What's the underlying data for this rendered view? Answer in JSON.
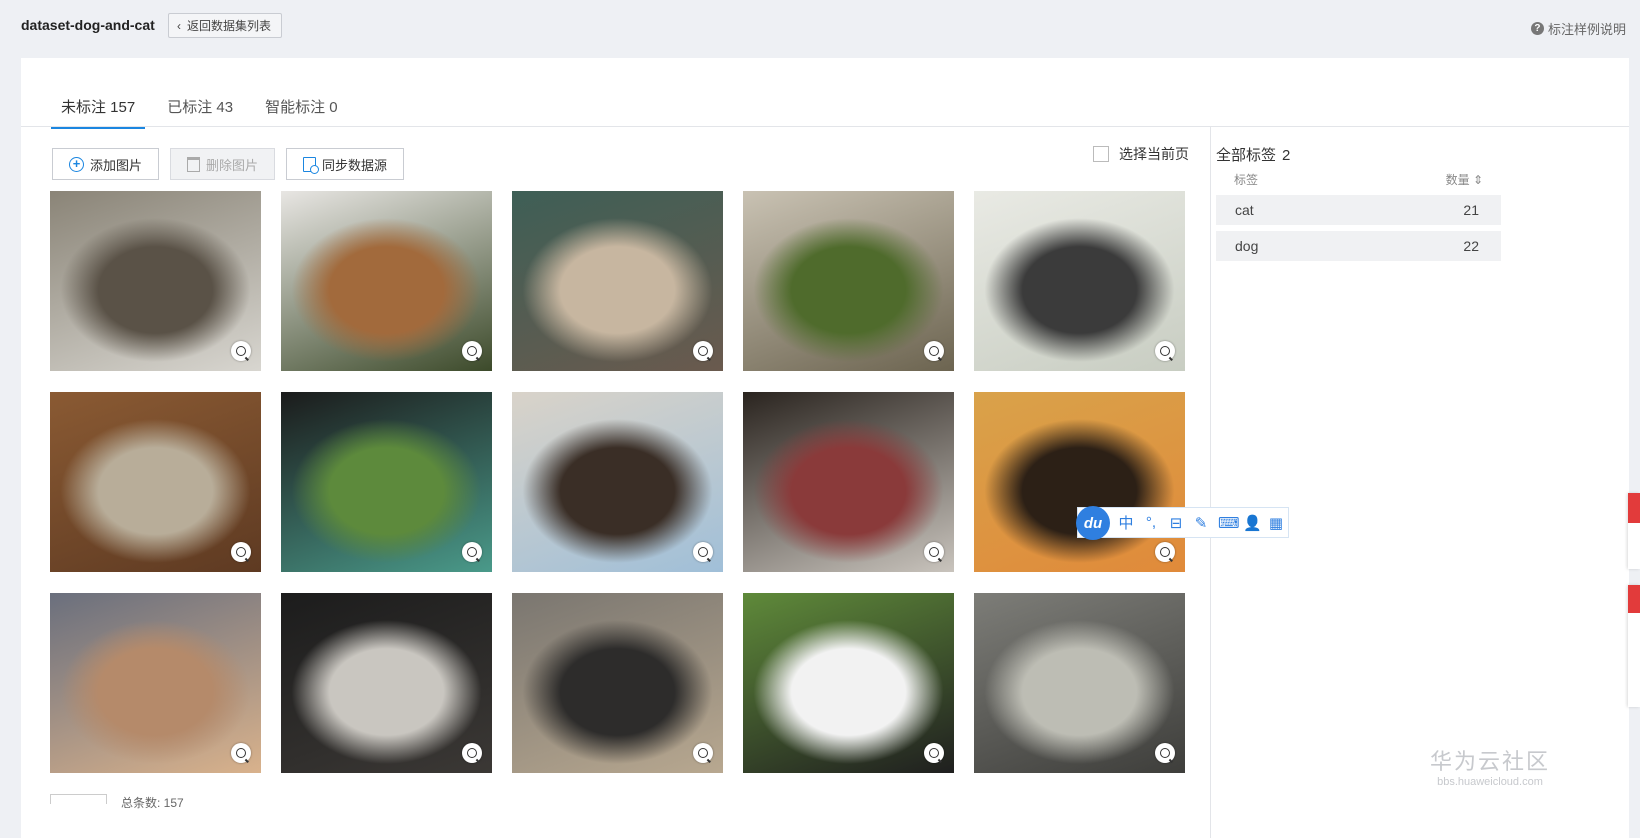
{
  "header": {
    "dataset_name": "dataset-dog-and-cat",
    "back_label": "返回数据集列表",
    "help_label": "标注样例说明"
  },
  "tabs": [
    {
      "label": "未标注 157",
      "active": true
    },
    {
      "label": "已标注 43",
      "active": false
    },
    {
      "label": "智能标注 0",
      "active": false
    }
  ],
  "toolbar": {
    "add_label": "添加图片",
    "delete_label": "删除图片",
    "sync_label": "同步数据源",
    "select_page_label": "选择当前页"
  },
  "images": [
    {
      "subject": "cat",
      "colors": [
        "#8a8477",
        "#5a5247",
        "#d8d6d0"
      ]
    },
    {
      "subject": "dog",
      "colors": [
        "#e8e6e3",
        "#a26a3c",
        "#3c4a2a"
      ]
    },
    {
      "subject": "dog",
      "colors": [
        "#3e5f56",
        "#c7b6a0",
        "#6a5a4e"
      ]
    },
    {
      "subject": "dog",
      "colors": [
        "#c9c2b3",
        "#4f6b2c",
        "#6c6450"
      ]
    },
    {
      "subject": "cat",
      "colors": [
        "#e9eae4",
        "#3b3b3b",
        "#c8cdc2"
      ]
    },
    {
      "subject": "dog",
      "colors": [
        "#8a5a33",
        "#b8ad99",
        "#5e3a22"
      ]
    },
    {
      "subject": "dog",
      "colors": [
        "#1b1b1b",
        "#5d8a3c",
        "#4a9a8a"
      ]
    },
    {
      "subject": "dog",
      "colors": [
        "#d9d3c9",
        "#3a2e26",
        "#a0bfd8"
      ]
    },
    {
      "subject": "dog",
      "colors": [
        "#2a241f",
        "#8a3a3a",
        "#c9c4bd"
      ]
    },
    {
      "subject": "cat",
      "colors": [
        "#d9a24a",
        "#2c2016",
        "#e08a3a"
      ]
    },
    {
      "subject": "cat",
      "colors": [
        "#6a6f7d",
        "#b58a6a",
        "#d9b28c"
      ]
    },
    {
      "subject": "cat",
      "colors": [
        "#1c1c1c",
        "#c9c6c0",
        "#3b3835"
      ]
    },
    {
      "subject": "dog",
      "colors": [
        "#7a7670",
        "#2d2c2b",
        "#b8a890"
      ]
    },
    {
      "subject": "dog",
      "colors": [
        "#5f8a3a",
        "#f2f2f2",
        "#1f1f1f"
      ]
    },
    {
      "subject": "cat",
      "colors": [
        "#7d7d78",
        "#bdbdb4",
        "#3e3e3b"
      ]
    }
  ],
  "labels_panel": {
    "title": "全部标签",
    "count": "2",
    "col_label": "标签",
    "col_count": "数量",
    "rows": [
      {
        "name": "cat",
        "count": "21"
      },
      {
        "name": "dog",
        "count": "22"
      }
    ]
  },
  "pager": {
    "total": "总条数: 157"
  },
  "ime": {
    "logo": "du",
    "items": [
      "中",
      "°,",
      "⊟",
      "✎",
      "⌨",
      "👤",
      "▦"
    ]
  },
  "watermark": {
    "line1": "华为云社区",
    "line2": "bbs.huaweicloud.com"
  },
  "colors": {
    "accent": "#1b86e0",
    "page_bg": "#eef0f4"
  }
}
